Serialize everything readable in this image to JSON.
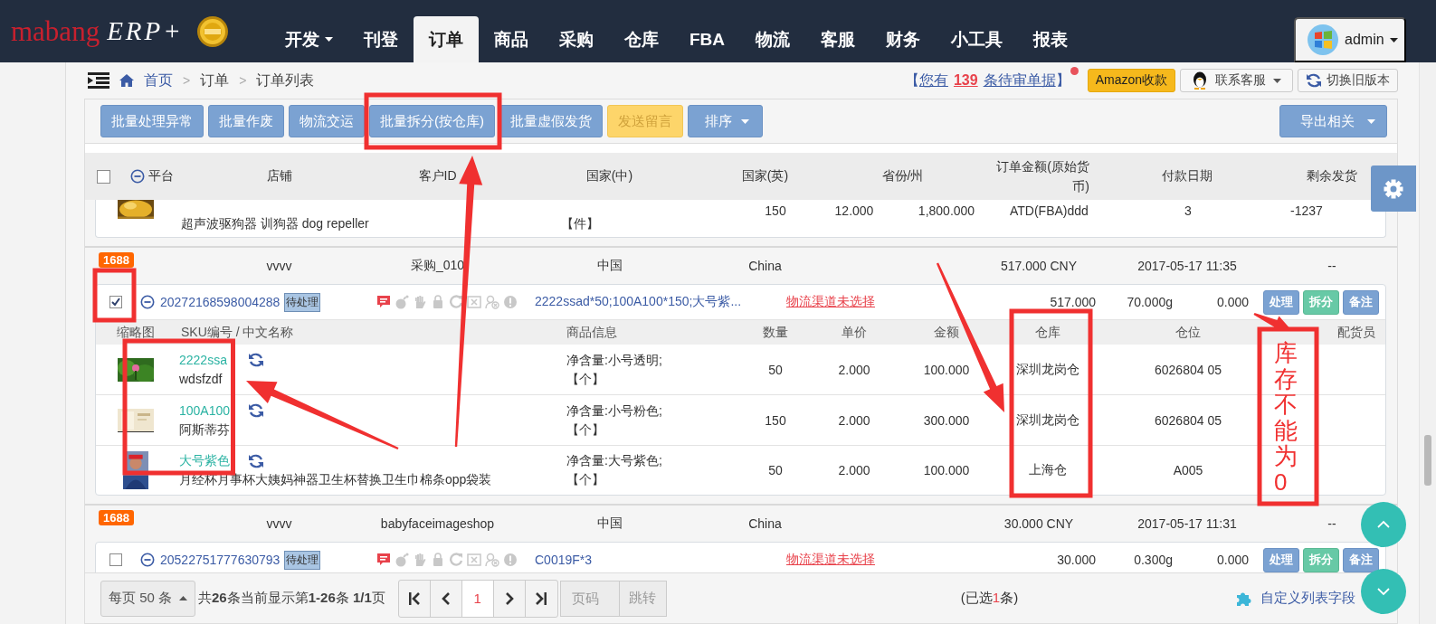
{
  "nav": {
    "brand": "mabang",
    "brand_suffix": "ERP+",
    "items": [
      {
        "label": "开发",
        "dropdown": true,
        "selected": false
      },
      {
        "label": "刊登",
        "dropdown": false,
        "selected": false
      },
      {
        "label": "订单",
        "dropdown": false,
        "selected": true
      },
      {
        "label": "商品",
        "dropdown": false,
        "selected": false
      },
      {
        "label": "采购",
        "dropdown": false,
        "selected": false
      },
      {
        "label": "仓库",
        "dropdown": false,
        "selected": false
      },
      {
        "label": "FBA",
        "dropdown": false,
        "selected": false
      },
      {
        "label": "物流",
        "dropdown": false,
        "selected": false
      },
      {
        "label": "客服",
        "dropdown": false,
        "selected": false
      },
      {
        "label": "财务",
        "dropdown": false,
        "selected": false
      },
      {
        "label": "小工具",
        "dropdown": false,
        "selected": false
      },
      {
        "label": "报表",
        "dropdown": false,
        "selected": false
      }
    ],
    "user": "admin"
  },
  "breadcrumb": {
    "items": [
      "首页",
      "订单",
      "订单列表"
    ],
    "separator": ">"
  },
  "notice": {
    "open": "【",
    "before": "您有",
    "count": "139",
    "after": "条待审单据",
    "close": "】",
    "unread": true
  },
  "header_buttons": [
    {
      "label": "Amazon收款",
      "kind": "amazon"
    },
    {
      "label": "联系客服",
      "kind": "contact"
    },
    {
      "label": "切换旧版本",
      "kind": "switch"
    }
  ],
  "toolbar": {
    "buttons": [
      {
        "label": "批量处理异常",
        "kind": "primary"
      },
      {
        "label": "批量作废",
        "kind": "primary"
      },
      {
        "label": "物流交运",
        "kind": "primary"
      },
      {
        "label": "批量拆分(按仓库)",
        "kind": "primary"
      },
      {
        "label": "批量虚假发货",
        "kind": "primary"
      },
      {
        "label": "发送留言",
        "kind": "warning"
      },
      {
        "label": "排序",
        "kind": "dropdown"
      }
    ],
    "export": "导出相关"
  },
  "table": {
    "all_checked": false,
    "columns": [
      "平台",
      "店铺",
      "客户ID",
      "国家(中)",
      "国家(英)",
      "省份/州",
      "订单金额(原始货币)",
      "付款日期",
      "剩余发货"
    ]
  },
  "partial_order": {
    "name": "超声波驱狗器 训狗器 dog repeller",
    "unit": "【件】",
    "qty": "150",
    "price": "12.000",
    "amount": "1,800.000",
    "warehouse": "ATD(FBA)ddd",
    "location": "3",
    "stock": "-1237"
  },
  "orders": [
    {
      "platform": "1688",
      "shop": "vvvv",
      "customer": "采购_010",
      "country_cn": "中国",
      "country_en": "China",
      "amount": "517.000 CNY",
      "paid": "2017-05-17 11:35",
      "remaining": "--",
      "checked": true,
      "order_no": "20272168598004288",
      "status": "待处理",
      "flags": [
        {
          "kind": "message",
          "on": true
        },
        {
          "kind": "bomb",
          "on": false
        },
        {
          "kind": "hand",
          "on": false
        },
        {
          "kind": "lock",
          "on": false
        },
        {
          "kind": "refresh",
          "on": false
        },
        {
          "kind": "card",
          "on": false
        },
        {
          "kind": "user",
          "on": false
        },
        {
          "kind": "alert",
          "on": false
        }
      ],
      "products": "2222ssad*50;100A100*150;大号紫...",
      "logistics": "物流渠道未选择",
      "total": "517.000",
      "weight": "70.000g",
      "fee": "0.000",
      "actions": [
        {
          "label": "处理",
          "kind": "primary"
        },
        {
          "label": "拆分",
          "kind": "success"
        },
        {
          "label": "备注",
          "kind": "primary"
        }
      ],
      "item_columns": {
        "thumb": "缩略图",
        "sku": "SKU编号 / 中文名称",
        "info": "商品信息",
        "qty": "数量",
        "price": "单价",
        "amount": "金额",
        "warehouse": "仓库",
        "location": "仓位",
        "picker": "配货员"
      },
      "items": [
        {
          "sku": "2222ssa",
          "name": "wdsfzdf",
          "info": "净含量:小号透明;",
          "unit": "【个】",
          "qty": "50",
          "price": "2.000",
          "amount": "100.000",
          "warehouse": "深圳龙岗仓",
          "location": "6026804 05"
        },
        {
          "sku": "100A100",
          "name": "阿斯蒂芬",
          "info": "净含量:小号粉色;",
          "unit": "【个】",
          "qty": "150",
          "price": "2.000",
          "amount": "300.000",
          "warehouse": "深圳龙岗仓",
          "location": "6026804 05"
        },
        {
          "sku": "大号紫色",
          "name": "月经杯月事杯大姨妈神器卫生杯替换卫生巾棉条opp袋装",
          "info": "净含量:大号紫色;",
          "unit": "【个】",
          "qty": "50",
          "price": "2.000",
          "amount": "100.000",
          "warehouse": "上海仓",
          "location": "A005"
        }
      ]
    },
    {
      "platform": "1688",
      "shop": "vvvv",
      "customer": "babyfaceimageshop",
      "country_cn": "中国",
      "country_en": "China",
      "amount": "30.000 CNY",
      "paid": "2017-05-17 11:31",
      "remaining": "--",
      "checked": false,
      "order_no": "20522751777630793",
      "status": "待处理",
      "flags": [
        {
          "kind": "message",
          "on": true
        },
        {
          "kind": "bomb",
          "on": false
        },
        {
          "kind": "hand",
          "on": false
        },
        {
          "kind": "lock",
          "on": false
        },
        {
          "kind": "refresh",
          "on": false
        },
        {
          "kind": "card",
          "on": false
        },
        {
          "kind": "user",
          "on": false
        },
        {
          "kind": "alert",
          "on": false
        }
      ],
      "products": "C0019F*3",
      "logistics": "物流渠道未选择",
      "total": "30.000",
      "weight": "0.300g",
      "fee": "0.000",
      "actions": [
        {
          "label": "处理",
          "kind": "primary"
        },
        {
          "label": "拆分",
          "kind": "success"
        },
        {
          "label": "备注",
          "kind": "primary"
        }
      ]
    }
  ],
  "footer": {
    "page_size": "每页 50 条",
    "summary": "共**26**条当前显示第**1-26**条 **1/1**页",
    "pages": [
      {
        "label": "1",
        "selected": true
      }
    ],
    "page_placeholder": "页码",
    "jump": "跳转",
    "selected_before": "(已选",
    "selected_count": "1",
    "selected_after": "条)",
    "customize": "自定义列表字段"
  },
  "annotation": {
    "note": "库存不能为0"
  }
}
